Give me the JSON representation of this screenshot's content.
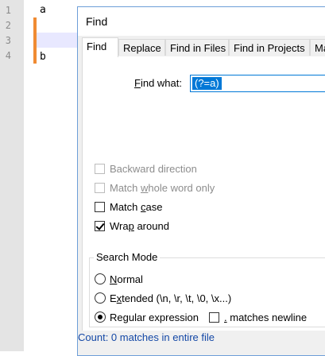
{
  "editor": {
    "line_numbers": [
      "1",
      "2",
      "3",
      "4"
    ],
    "lines": [
      "a",
      "",
      "",
      "b"
    ],
    "accent_color": "#f08b33"
  },
  "dialog": {
    "title": "Find",
    "tabs": [
      {
        "label": "Find",
        "active": true
      },
      {
        "label": "Replace"
      },
      {
        "label": "Find in Files"
      },
      {
        "label": "Find in Projects"
      },
      {
        "label": "Ma"
      }
    ],
    "find_what_prefix": "F",
    "find_what_rest": "ind what:",
    "find_value": "(?=a)",
    "options": {
      "backward": "Backward direction",
      "whole_word_pre": "Match ",
      "whole_word_u": "w",
      "whole_word_post": "hole word only",
      "match_case_pre": "Match ",
      "match_case_u": "c",
      "match_case_post": "ase",
      "wrap_pre": "Wra",
      "wrap_u": "p",
      "wrap_post": " around"
    },
    "search_mode": {
      "title": "Search Mode",
      "normal_u": "N",
      "normal_post": "ormal",
      "extended_pre": "E",
      "extended_u": "x",
      "extended_post": "tended (\\n, \\r, \\t, \\0, \\x...)",
      "regex_pre": "Re",
      "regex_u": "g",
      "regex_post": "ular expression",
      "newline_u": ".",
      "newline_post": " matches newline"
    },
    "status": "Count: 0 matches in entire file"
  }
}
